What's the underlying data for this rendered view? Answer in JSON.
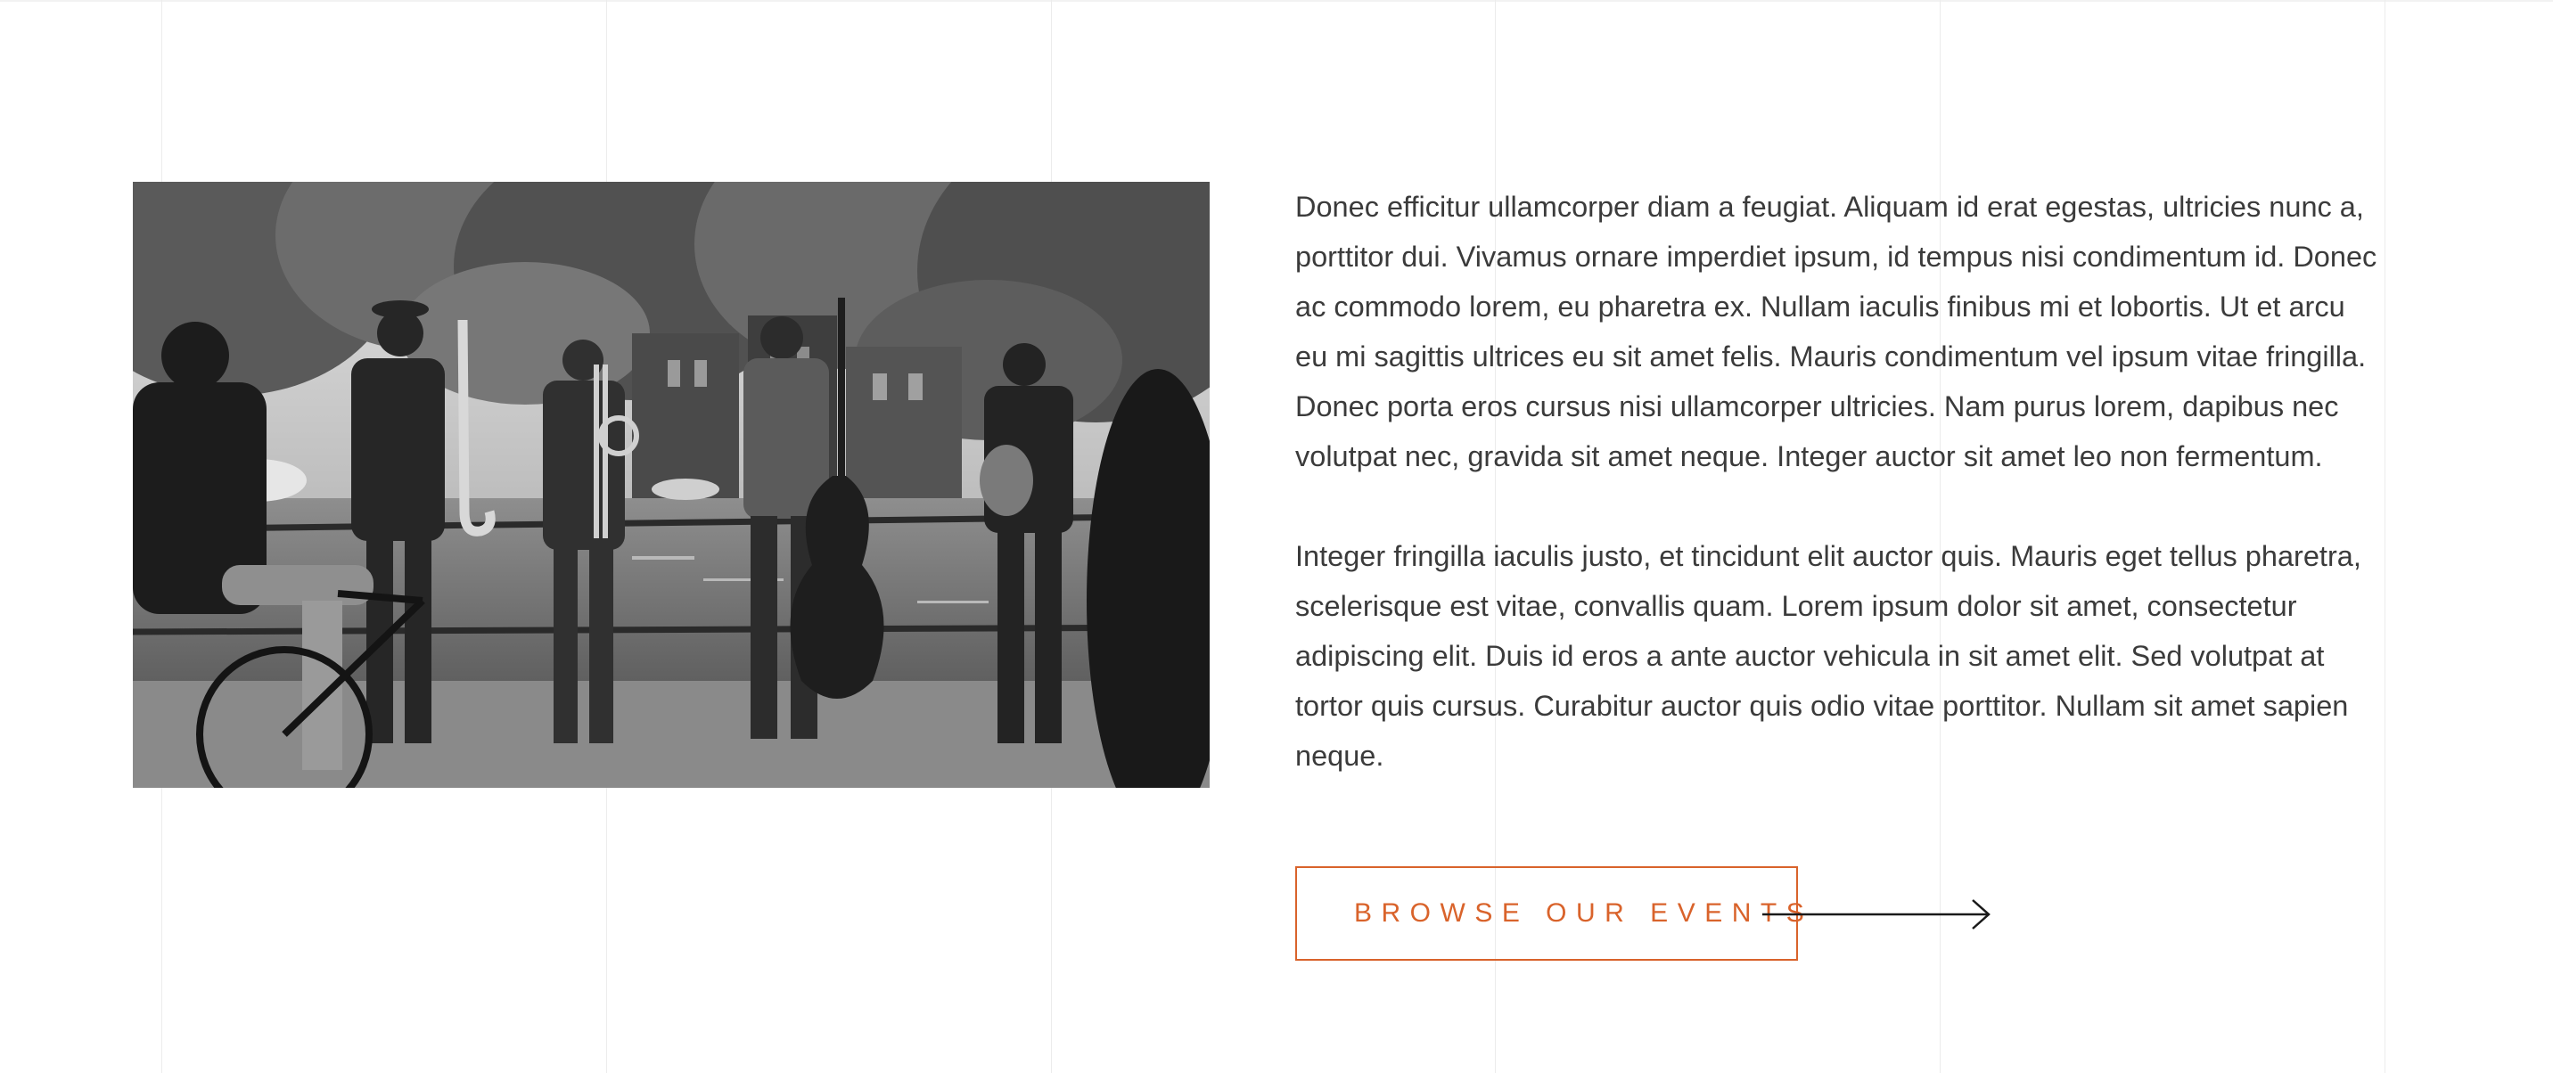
{
  "content": {
    "paragraphs": [
      "Donec efficitur ullamcorper diam a feugiat. Aliquam id erat egestas, ultricies nunc a, porttitor dui. Vivamus ornare imperdiet ipsum, id tempus nisi condimentum id. Donec ac commodo lorem, eu pharetra ex. Nullam iaculis finibus mi et lobortis. Ut et arcu eu mi sagittis ultrices eu sit amet felis. Mauris condimentum vel ipsum vitae fringilla. Donec porta eros cursus nisi ullamcorper ultricies. Nam purus lorem, dapibus nec volutpat nec, gravida sit amet neque. Integer auctor sit amet leo non fermentum.",
      "Integer fringilla iaculis justo, et tincidunt elit auctor quis. Mauris eget tellus pharetra, scelerisque est vitae, convallis quam. Lorem ipsum dolor sit amet, consectetur adipiscing elit. Duis id eros a ante auctor vehicula in sit amet elit. Sed volutpat at tortor quis cursus. Curabitur auctor quis odio vitae porttitor. Nullam sit amet sapien neque."
    ],
    "cta": {
      "label": "BROWSE OUR EVENTS",
      "icon": "arrow-right-icon"
    }
  },
  "photo": {
    "tone": "grayscale"
  },
  "colors": {
    "accent": "#d9632b",
    "text": "#3b3b3b",
    "gridline": "#ececec",
    "background": "#ffffff"
  }
}
